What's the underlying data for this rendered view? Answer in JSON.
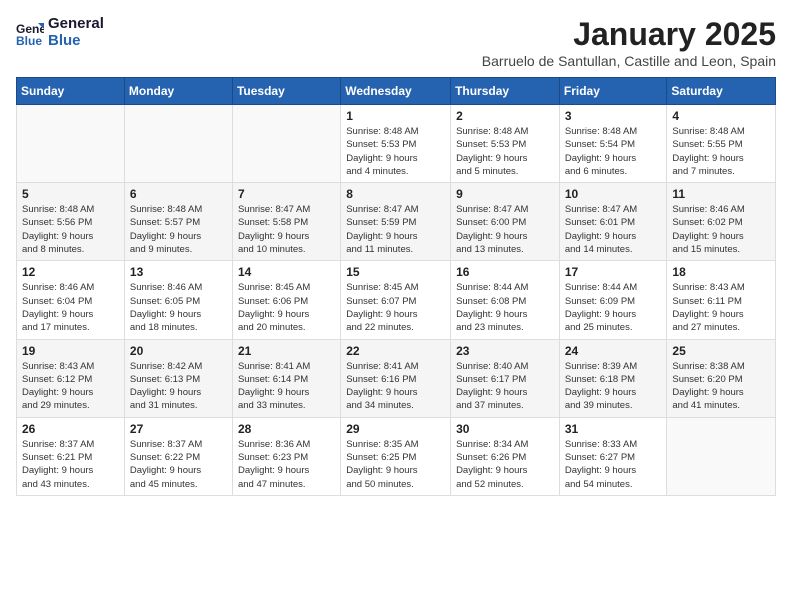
{
  "logo": {
    "line1": "General",
    "line2": "Blue"
  },
  "header": {
    "month": "January 2025",
    "location": "Barruelo de Santullan, Castille and Leon, Spain"
  },
  "weekdays": [
    "Sunday",
    "Monday",
    "Tuesday",
    "Wednesday",
    "Thursday",
    "Friday",
    "Saturday"
  ],
  "weeks": [
    [
      {
        "day": "",
        "info": ""
      },
      {
        "day": "",
        "info": ""
      },
      {
        "day": "",
        "info": ""
      },
      {
        "day": "1",
        "info": "Sunrise: 8:48 AM\nSunset: 5:53 PM\nDaylight: 9 hours\nand 4 minutes."
      },
      {
        "day": "2",
        "info": "Sunrise: 8:48 AM\nSunset: 5:53 PM\nDaylight: 9 hours\nand 5 minutes."
      },
      {
        "day": "3",
        "info": "Sunrise: 8:48 AM\nSunset: 5:54 PM\nDaylight: 9 hours\nand 6 minutes."
      },
      {
        "day": "4",
        "info": "Sunrise: 8:48 AM\nSunset: 5:55 PM\nDaylight: 9 hours\nand 7 minutes."
      }
    ],
    [
      {
        "day": "5",
        "info": "Sunrise: 8:48 AM\nSunset: 5:56 PM\nDaylight: 9 hours\nand 8 minutes."
      },
      {
        "day": "6",
        "info": "Sunrise: 8:48 AM\nSunset: 5:57 PM\nDaylight: 9 hours\nand 9 minutes."
      },
      {
        "day": "7",
        "info": "Sunrise: 8:47 AM\nSunset: 5:58 PM\nDaylight: 9 hours\nand 10 minutes."
      },
      {
        "day": "8",
        "info": "Sunrise: 8:47 AM\nSunset: 5:59 PM\nDaylight: 9 hours\nand 11 minutes."
      },
      {
        "day": "9",
        "info": "Sunrise: 8:47 AM\nSunset: 6:00 PM\nDaylight: 9 hours\nand 13 minutes."
      },
      {
        "day": "10",
        "info": "Sunrise: 8:47 AM\nSunset: 6:01 PM\nDaylight: 9 hours\nand 14 minutes."
      },
      {
        "day": "11",
        "info": "Sunrise: 8:46 AM\nSunset: 6:02 PM\nDaylight: 9 hours\nand 15 minutes."
      }
    ],
    [
      {
        "day": "12",
        "info": "Sunrise: 8:46 AM\nSunset: 6:04 PM\nDaylight: 9 hours\nand 17 minutes."
      },
      {
        "day": "13",
        "info": "Sunrise: 8:46 AM\nSunset: 6:05 PM\nDaylight: 9 hours\nand 18 minutes."
      },
      {
        "day": "14",
        "info": "Sunrise: 8:45 AM\nSunset: 6:06 PM\nDaylight: 9 hours\nand 20 minutes."
      },
      {
        "day": "15",
        "info": "Sunrise: 8:45 AM\nSunset: 6:07 PM\nDaylight: 9 hours\nand 22 minutes."
      },
      {
        "day": "16",
        "info": "Sunrise: 8:44 AM\nSunset: 6:08 PM\nDaylight: 9 hours\nand 23 minutes."
      },
      {
        "day": "17",
        "info": "Sunrise: 8:44 AM\nSunset: 6:09 PM\nDaylight: 9 hours\nand 25 minutes."
      },
      {
        "day": "18",
        "info": "Sunrise: 8:43 AM\nSunset: 6:11 PM\nDaylight: 9 hours\nand 27 minutes."
      }
    ],
    [
      {
        "day": "19",
        "info": "Sunrise: 8:43 AM\nSunset: 6:12 PM\nDaylight: 9 hours\nand 29 minutes."
      },
      {
        "day": "20",
        "info": "Sunrise: 8:42 AM\nSunset: 6:13 PM\nDaylight: 9 hours\nand 31 minutes."
      },
      {
        "day": "21",
        "info": "Sunrise: 8:41 AM\nSunset: 6:14 PM\nDaylight: 9 hours\nand 33 minutes."
      },
      {
        "day": "22",
        "info": "Sunrise: 8:41 AM\nSunset: 6:16 PM\nDaylight: 9 hours\nand 34 minutes."
      },
      {
        "day": "23",
        "info": "Sunrise: 8:40 AM\nSunset: 6:17 PM\nDaylight: 9 hours\nand 37 minutes."
      },
      {
        "day": "24",
        "info": "Sunrise: 8:39 AM\nSunset: 6:18 PM\nDaylight: 9 hours\nand 39 minutes."
      },
      {
        "day": "25",
        "info": "Sunrise: 8:38 AM\nSunset: 6:20 PM\nDaylight: 9 hours\nand 41 minutes."
      }
    ],
    [
      {
        "day": "26",
        "info": "Sunrise: 8:37 AM\nSunset: 6:21 PM\nDaylight: 9 hours\nand 43 minutes."
      },
      {
        "day": "27",
        "info": "Sunrise: 8:37 AM\nSunset: 6:22 PM\nDaylight: 9 hours\nand 45 minutes."
      },
      {
        "day": "28",
        "info": "Sunrise: 8:36 AM\nSunset: 6:23 PM\nDaylight: 9 hours\nand 47 minutes."
      },
      {
        "day": "29",
        "info": "Sunrise: 8:35 AM\nSunset: 6:25 PM\nDaylight: 9 hours\nand 50 minutes."
      },
      {
        "day": "30",
        "info": "Sunrise: 8:34 AM\nSunset: 6:26 PM\nDaylight: 9 hours\nand 52 minutes."
      },
      {
        "day": "31",
        "info": "Sunrise: 8:33 AM\nSunset: 6:27 PM\nDaylight: 9 hours\nand 54 minutes."
      },
      {
        "day": "",
        "info": ""
      }
    ]
  ]
}
